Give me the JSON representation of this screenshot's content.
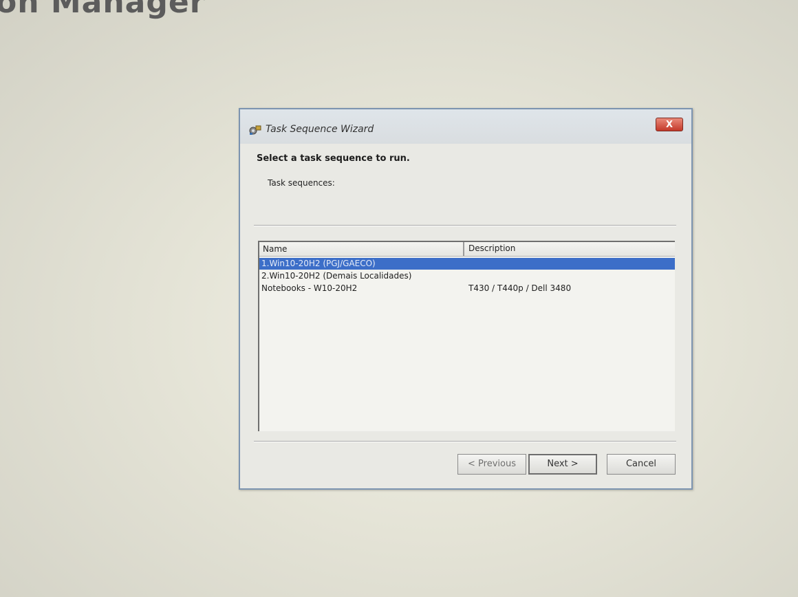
{
  "background": {
    "title_fragment": "on Manager"
  },
  "dialog": {
    "title": "Task Sequence Wizard",
    "close_label": "X",
    "heading": "Select a task sequence to run.",
    "list_label": "Task sequences:",
    "columns": {
      "name": "Name",
      "description": "Description"
    },
    "rows": [
      {
        "name": "1.Win10-20H2 (PGJ/GAECO)",
        "description": "",
        "selected": true
      },
      {
        "name": "2.Win10-20H2 (Demais Localidades)",
        "description": "",
        "selected": false
      },
      {
        "name": "Notebooks - W10-20H2",
        "description": "T430 / T440p / Dell 3480",
        "selected": false
      }
    ],
    "buttons": {
      "previous": "< Previous",
      "next": "Next >",
      "cancel": "Cancel"
    }
  },
  "colors": {
    "selection": "#3c6ec8",
    "close_button": "#c4392a",
    "dialog_border": "#7c94b0"
  },
  "icons": {
    "app": "task-sequence-gear-icon"
  }
}
